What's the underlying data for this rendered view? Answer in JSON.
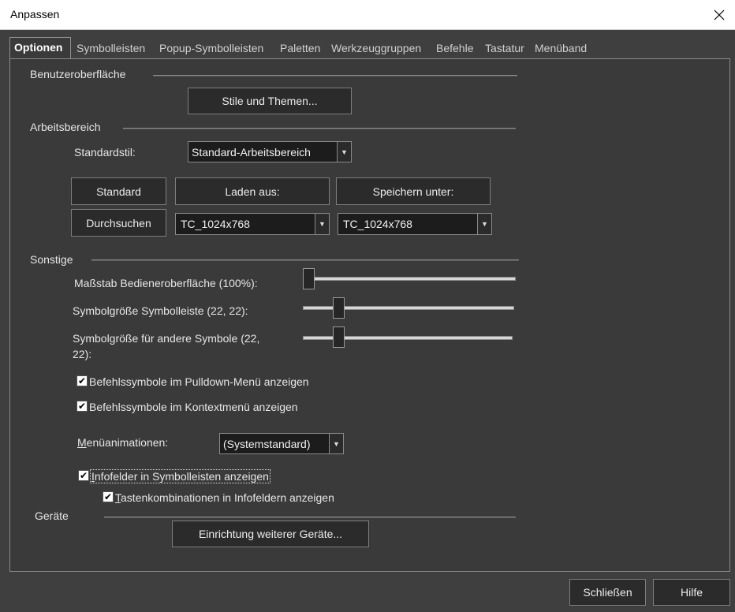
{
  "window": {
    "title": "Anpassen",
    "close_icon": "×"
  },
  "tabs": [
    {
      "label": "Optionen",
      "active": true
    },
    {
      "label": "Symbolleisten"
    },
    {
      "label": "Popup-Symbolleisten"
    },
    {
      "label": "Paletten"
    },
    {
      "label": "Werkzeuggruppen"
    },
    {
      "label": "Befehle"
    },
    {
      "label": "Tastatur"
    },
    {
      "label": "Menüband"
    }
  ],
  "ui_section": {
    "label": "Benutzeroberfläche",
    "styles_button": "Stile und Themen..."
  },
  "workspace": {
    "label": "Arbeitsbereich",
    "default_style_label": "Standardstil:",
    "default_style_value": "Standard-Arbeitsbereich",
    "standard_button": "Standard",
    "load_button": "Laden aus:",
    "save_button": "Speichern unter:",
    "browse_button": "Durchsuchen",
    "load_value": "TC_1024x768",
    "save_value": "TC_1024x768"
  },
  "misc": {
    "label": "Sonstige",
    "scale_label": "Maßstab Bedieneroberfläche (100%):",
    "toolbar_icon_label": "Symbolgröße Symbolleiste (22, 22):",
    "other_icon_label_1": "Symbolgröße für andere Symbole (22,",
    "other_icon_label_2": "22):",
    "scale_value": 0.0,
    "toolbar_icon_value": 0.15,
    "other_icon_value": 0.15,
    "pulldown_icons_label": "Befehlssymbole im Pulldown-Menü anzeigen",
    "context_icons_label": "Befehlssymbole im Kontextmenü anzeigen",
    "menu_anim_label_first": "M",
    "menu_anim_label_rest": "enüanimationen:",
    "menu_anim_value": "(Systemstandard)",
    "tooltips_label_first": "I",
    "tooltips_label_rest": "nfofelder in Symbolleisten anzeigen",
    "shortcuts_label_first": "T",
    "shortcuts_label_rest": "astenkombinationen in Infofeldern anzeigen",
    "check_mark": "✔"
  },
  "devices": {
    "label": "Geräte",
    "setup_button": "Einrichtung weiterer Geräte..."
  },
  "footer": {
    "close_button": "Schließen",
    "help_button": "Hilfe"
  },
  "colors": {
    "background": "#3f3f3f",
    "panel": "#3a3a3a",
    "button": "#2b2b2b",
    "combo": "#1c1c1c"
  }
}
